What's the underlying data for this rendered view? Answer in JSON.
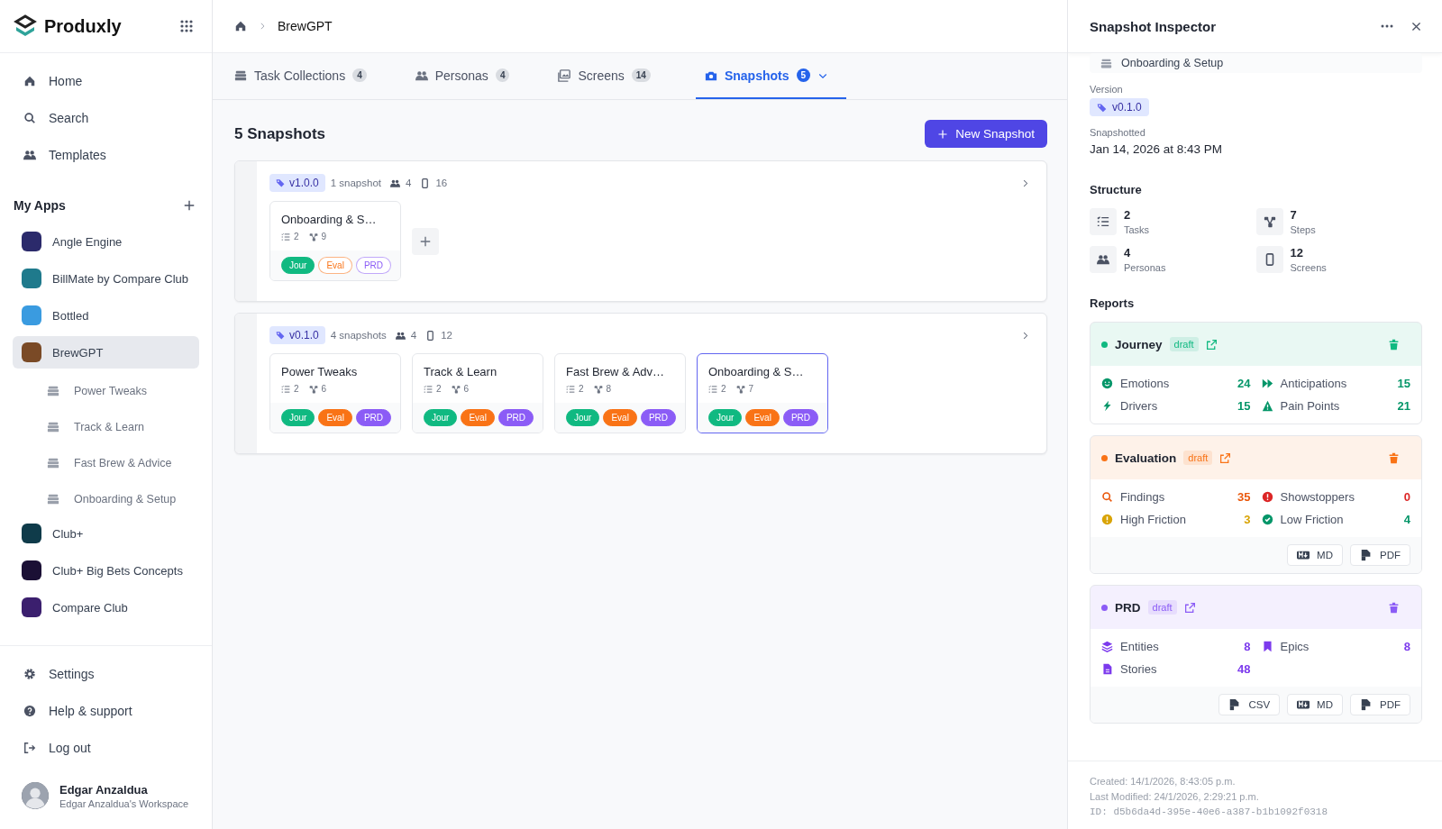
{
  "app": {
    "name": "Produxly"
  },
  "nav": [
    {
      "label": "Home",
      "kind": "home"
    },
    {
      "label": "Search",
      "kind": "search"
    },
    {
      "label": "Templates",
      "kind": "users"
    }
  ],
  "my_apps": {
    "title": "My Apps",
    "items": [
      {
        "label": "Angle Engine",
        "color": "#2b2a6b",
        "selected": false
      },
      {
        "label": "BillMate by Compare Club",
        "color": "#1f7a8c",
        "selected": false
      },
      {
        "label": "Bottled",
        "color": "#3a9be0",
        "selected": false
      },
      {
        "label": "BrewGPT",
        "color": "#7a4a26",
        "selected": true,
        "children": [
          {
            "label": "Power Tweaks"
          },
          {
            "label": "Track & Learn"
          },
          {
            "label": "Fast Brew & Advice"
          },
          {
            "label": "Onboarding & Setup"
          }
        ]
      },
      {
        "label": "Club+",
        "color": "#0f3b4a",
        "selected": false
      },
      {
        "label": "Club+ Big Bets Concepts",
        "color": "#1b1035",
        "selected": false
      },
      {
        "label": "Compare Club",
        "color": "#3b1f6e",
        "selected": false
      }
    ]
  },
  "footer_nav": [
    {
      "label": "Settings",
      "kind": "gear"
    },
    {
      "label": "Help & support",
      "kind": "help"
    },
    {
      "label": "Log out",
      "kind": "logout"
    }
  ],
  "user": {
    "name": "Edgar Anzaldua",
    "workspace": "Edgar Anzaldua's Workspace"
  },
  "breadcrumb": [
    "BrewGPT"
  ],
  "tabs": [
    {
      "label": "Task Collections",
      "count": "4",
      "kind": "stack",
      "selected": false
    },
    {
      "label": "Personas",
      "count": "4",
      "kind": "users",
      "selected": false
    },
    {
      "label": "Screens",
      "count": "14",
      "kind": "images",
      "selected": false
    },
    {
      "label": "Snapshots",
      "count": "5",
      "kind": "camera",
      "selected": true
    }
  ],
  "heading": "5 Snapshots",
  "new_button": "New Snapshot",
  "versions": [
    {
      "version": "v1.0.0",
      "count": "1 snapshot",
      "personas": "4",
      "screens": "16",
      "can_add": true,
      "snapshots": [
        {
          "title": "Onboarding & S…",
          "tasks": "2",
          "steps": "9",
          "selected": false,
          "reports": [
            {
              "label": "Jour",
              "kind": "journey",
              "filled": true
            },
            {
              "label": "Eval",
              "kind": "evaluation",
              "filled": false
            },
            {
              "label": "PRD",
              "kind": "prd",
              "filled": false
            }
          ]
        }
      ]
    },
    {
      "version": "v0.1.0",
      "count": "4 snapshots",
      "personas": "4",
      "screens": "12",
      "can_add": false,
      "snapshots": [
        {
          "title": "Power Tweaks",
          "tasks": "2",
          "steps": "6",
          "selected": false,
          "reports": [
            {
              "label": "Jour",
              "kind": "journey",
              "filled": true
            },
            {
              "label": "Eval",
              "kind": "evaluation",
              "filled": true
            },
            {
              "label": "PRD",
              "kind": "prd",
              "filled": true
            }
          ]
        },
        {
          "title": "Track & Learn",
          "tasks": "2",
          "steps": "6",
          "selected": false,
          "reports": [
            {
              "label": "Jour",
              "kind": "journey",
              "filled": true
            },
            {
              "label": "Eval",
              "kind": "evaluation",
              "filled": true
            },
            {
              "label": "PRD",
              "kind": "prd",
              "filled": true
            }
          ]
        },
        {
          "title": "Fast Brew & Adv…",
          "tasks": "2",
          "steps": "8",
          "selected": false,
          "reports": [
            {
              "label": "Jour",
              "kind": "journey",
              "filled": true
            },
            {
              "label": "Eval",
              "kind": "evaluation",
              "filled": true
            },
            {
              "label": "PRD",
              "kind": "prd",
              "filled": true
            }
          ]
        },
        {
          "title": "Onboarding & S…",
          "tasks": "2",
          "steps": "7",
          "selected": true,
          "reports": [
            {
              "label": "Jour",
              "kind": "journey",
              "filled": true
            },
            {
              "label": "Eval",
              "kind": "evaluation",
              "filled": true
            },
            {
              "label": "PRD",
              "kind": "prd",
              "filled": true
            }
          ]
        }
      ]
    }
  ],
  "inspector": {
    "title": "Snapshot Inspector",
    "collection": "Onboarding & Setup",
    "version_label": "Version",
    "version": "v0.1.0",
    "snapshotted_label": "Snapshotted",
    "snapshotted": "Jan 14, 2026 at 8:43 PM",
    "structure_title": "Structure",
    "structure": [
      {
        "value": "2",
        "label": "Tasks",
        "kind": "tasks"
      },
      {
        "value": "7",
        "label": "Steps",
        "kind": "steps"
      },
      {
        "value": "4",
        "label": "Personas",
        "kind": "users"
      },
      {
        "value": "12",
        "label": "Screens",
        "kind": "phone"
      }
    ],
    "reports_title": "Reports",
    "reports": [
      {
        "name": "Journey",
        "status": "draft",
        "color": "#10b981",
        "metrics": [
          {
            "label": "Emotions",
            "value": "24",
            "kind": "smile",
            "color": "#059669"
          },
          {
            "label": "Anticipations",
            "value": "15",
            "kind": "forward",
            "color": "#059669"
          },
          {
            "label": "Drivers",
            "value": "15",
            "kind": "bolt",
            "color": "#059669"
          },
          {
            "label": "Pain Points",
            "value": "21",
            "kind": "warning",
            "color": "#059669"
          }
        ]
      },
      {
        "name": "Evaluation",
        "status": "draft",
        "color": "#f97316",
        "metrics": [
          {
            "label": "Findings",
            "value": "35",
            "kind": "search",
            "color": "#ea580c"
          },
          {
            "label": "Showstoppers",
            "value": "0",
            "kind": "alert",
            "color": "#dc2626"
          },
          {
            "label": "High Friction",
            "value": "3",
            "kind": "alert",
            "color": "#d9a406"
          },
          {
            "label": "Low Friction",
            "value": "4",
            "kind": "check",
            "color": "#059669"
          }
        ],
        "exports": [
          {
            "label": "MD",
            "kind": "markdown"
          },
          {
            "label": "PDF",
            "kind": "file"
          }
        ]
      },
      {
        "name": "PRD",
        "status": "draft",
        "color": "#8b5cf6",
        "metrics": [
          {
            "label": "Entities",
            "value": "8",
            "kind": "layers",
            "color": "#7c3aed"
          },
          {
            "label": "Epics",
            "value": "8",
            "kind": "bookmark",
            "color": "#7c3aed"
          },
          {
            "label": "Stories",
            "value": "48",
            "kind": "doc",
            "color": "#7c3aed"
          }
        ],
        "exports": [
          {
            "label": "CSV",
            "kind": "file"
          },
          {
            "label": "MD",
            "kind": "markdown"
          },
          {
            "label": "PDF",
            "kind": "file"
          }
        ]
      }
    ],
    "meta": [
      "Created: 14/1/2026, 8:43:05 p.m.",
      "Last Modified: 24/1/2026, 2:29:21 p.m."
    ],
    "id": "ID: d5b6da4d-395e-40e6-a387-b1b1092f0318"
  }
}
